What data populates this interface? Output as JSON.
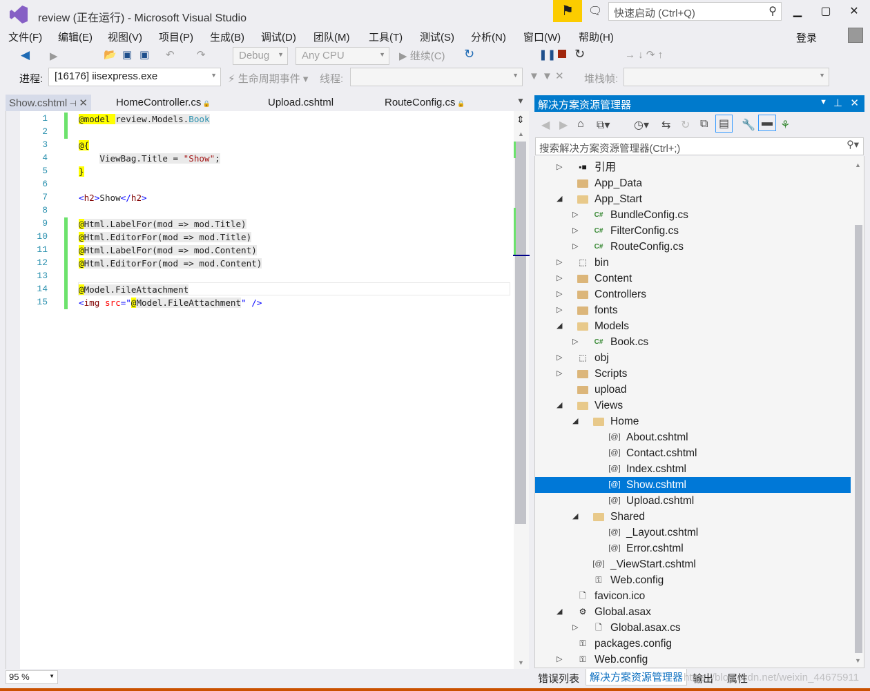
{
  "window": {
    "title": "review (正在运行) - Microsoft Visual Studio",
    "quick_launch": "快速启动 (Ctrl+Q)",
    "login": "登录"
  },
  "menu": [
    "文件(F)",
    "编辑(E)",
    "视图(V)",
    "项目(P)",
    "生成(B)",
    "调试(D)",
    "团队(M)",
    "工具(T)",
    "测试(S)",
    "分析(N)",
    "窗口(W)",
    "帮助(H)"
  ],
  "toolbar": {
    "config": "Debug",
    "platform": "Any CPU",
    "continue": "继续(C)",
    "process_label": "进程:",
    "process": "[16176] iisexpress.exe",
    "lifecycle": "生命周期事件",
    "thread_label": "线程:",
    "stack_label": "堆栈帧:"
  },
  "tabs": [
    {
      "label": "Show.cshtml",
      "active": true
    },
    {
      "label": "HomeController.cs"
    },
    {
      "label": "Upload.cshtml"
    },
    {
      "label": "RouteConfig.cs"
    }
  ],
  "code": [
    [
      [
        "@model",
        "hl"
      ],
      [
        " ",
        "hl"
      ],
      [
        "review.Models.",
        "bg"
      ],
      [
        "Book",
        "typ bg"
      ]
    ],
    [],
    [
      [
        "@{",
        "hl"
      ]
    ],
    [
      [
        "    "
      ],
      [
        "ViewBag.Title = ",
        "bg"
      ],
      [
        "\"Show\"",
        "str bg"
      ],
      [
        ";",
        "bg"
      ]
    ],
    [
      [
        "}",
        "hl"
      ]
    ],
    [],
    [
      [
        "<",
        "delim"
      ],
      [
        "h2",
        "tag"
      ],
      [
        ">",
        "delim"
      ],
      [
        "Show"
      ],
      [
        "</",
        "delim"
      ],
      [
        "h2",
        "tag"
      ],
      [
        ">",
        "delim"
      ]
    ],
    [],
    [
      [
        "@",
        "hl"
      ],
      [
        "Html.LabelFor(mod => mod.Title)",
        "bg"
      ]
    ],
    [
      [
        "@",
        "hl"
      ],
      [
        "Html.EditorFor(mod => mod.Title)",
        "bg"
      ]
    ],
    [
      [
        "@",
        "hl"
      ],
      [
        "Html.LabelFor(mod => mod.Content)",
        "bg"
      ]
    ],
    [
      [
        "@",
        "hl"
      ],
      [
        "Html.EditorFor(mod => mod.Content)",
        "bg"
      ]
    ],
    [],
    [
      [
        "@",
        "hl"
      ],
      [
        "Model.FileAttachment",
        "bg"
      ]
    ],
    [
      [
        "<",
        "delim"
      ],
      [
        "img",
        "tag"
      ],
      [
        " "
      ],
      [
        "src",
        "attr"
      ],
      [
        "=\"",
        "delim"
      ],
      [
        "@",
        "hl"
      ],
      [
        "Model.FileAttachment",
        "bg"
      ],
      [
        "\"",
        "delim"
      ],
      [
        " />",
        "delim"
      ]
    ]
  ],
  "changed_lines": [
    1,
    2,
    9,
    10,
    11,
    12,
    13,
    14,
    15
  ],
  "zoom_level": "95 %",
  "solution_explorer": {
    "title": "解决方案资源管理器",
    "search_placeholder": "搜索解决方案资源管理器(Ctrl+;)",
    "items": [
      {
        "label": "引用",
        "depth": 0,
        "state": "collapsed",
        "icon": "references"
      },
      {
        "label": "App_Data",
        "depth": 0,
        "state": "none",
        "icon": "folder"
      },
      {
        "label": "App_Start",
        "depth": 0,
        "state": "expanded",
        "icon": "folder-open"
      },
      {
        "label": "BundleConfig.cs",
        "depth": 1,
        "state": "collapsed",
        "icon": "csharp"
      },
      {
        "label": "FilterConfig.cs",
        "depth": 1,
        "state": "collapsed",
        "icon": "csharp"
      },
      {
        "label": "RouteConfig.cs",
        "depth": 1,
        "state": "collapsed",
        "icon": "csharp"
      },
      {
        "label": "bin",
        "depth": 0,
        "state": "collapsed",
        "icon": "folder-hidden"
      },
      {
        "label": "Content",
        "depth": 0,
        "state": "collapsed",
        "icon": "folder"
      },
      {
        "label": "Controllers",
        "depth": 0,
        "state": "collapsed",
        "icon": "folder"
      },
      {
        "label": "fonts",
        "depth": 0,
        "state": "collapsed",
        "icon": "folder"
      },
      {
        "label": "Models",
        "depth": 0,
        "state": "expanded",
        "icon": "folder-open"
      },
      {
        "label": "Book.cs",
        "depth": 1,
        "state": "collapsed",
        "icon": "csharp"
      },
      {
        "label": "obj",
        "depth": 0,
        "state": "collapsed",
        "icon": "folder-hidden"
      },
      {
        "label": "Scripts",
        "depth": 0,
        "state": "collapsed",
        "icon": "folder"
      },
      {
        "label": "upload",
        "depth": 0,
        "state": "none",
        "icon": "folder"
      },
      {
        "label": "Views",
        "depth": 0,
        "state": "expanded",
        "icon": "folder-open"
      },
      {
        "label": "Home",
        "depth": 1,
        "state": "expanded",
        "icon": "folder-open"
      },
      {
        "label": "About.cshtml",
        "depth": 2,
        "state": "none",
        "icon": "razor"
      },
      {
        "label": "Contact.cshtml",
        "depth": 2,
        "state": "none",
        "icon": "razor"
      },
      {
        "label": "Index.cshtml",
        "depth": 2,
        "state": "none",
        "icon": "razor"
      },
      {
        "label": "Show.cshtml",
        "depth": 2,
        "state": "none",
        "icon": "razor",
        "selected": true
      },
      {
        "label": "Upload.cshtml",
        "depth": 2,
        "state": "none",
        "icon": "razor"
      },
      {
        "label": "Shared",
        "depth": 1,
        "state": "expanded",
        "icon": "folder-open"
      },
      {
        "label": "_Layout.cshtml",
        "depth": 2,
        "state": "none",
        "icon": "razor"
      },
      {
        "label": "Error.cshtml",
        "depth": 2,
        "state": "none",
        "icon": "razor"
      },
      {
        "label": "_ViewStart.cshtml",
        "depth": 1,
        "state": "none",
        "icon": "razor"
      },
      {
        "label": "Web.config",
        "depth": 1,
        "state": "none",
        "icon": "config"
      },
      {
        "label": "favicon.ico",
        "depth": 0,
        "state": "none",
        "icon": "file"
      },
      {
        "label": "Global.asax",
        "depth": 0,
        "state": "expanded",
        "icon": "asax"
      },
      {
        "label": "Global.asax.cs",
        "depth": 1,
        "state": "collapsed",
        "icon": "file-cs"
      },
      {
        "label": "packages.config",
        "depth": 0,
        "state": "none",
        "icon": "config"
      },
      {
        "label": "Web.config",
        "depth": 0,
        "state": "collapsed",
        "icon": "config"
      }
    ]
  },
  "bottom_tabs": [
    {
      "label": "错误列表"
    },
    {
      "label": "解决方案资源管理器",
      "active": true
    },
    {
      "label": "输出"
    },
    {
      "label": "属性"
    }
  ],
  "watermark": "https://blog.csdn.net/weixin_44675911",
  "colors": {
    "accent": "#007acc",
    "selection": "#0078d7",
    "status_bar": "#ca5100",
    "notification": "#fccc00"
  }
}
